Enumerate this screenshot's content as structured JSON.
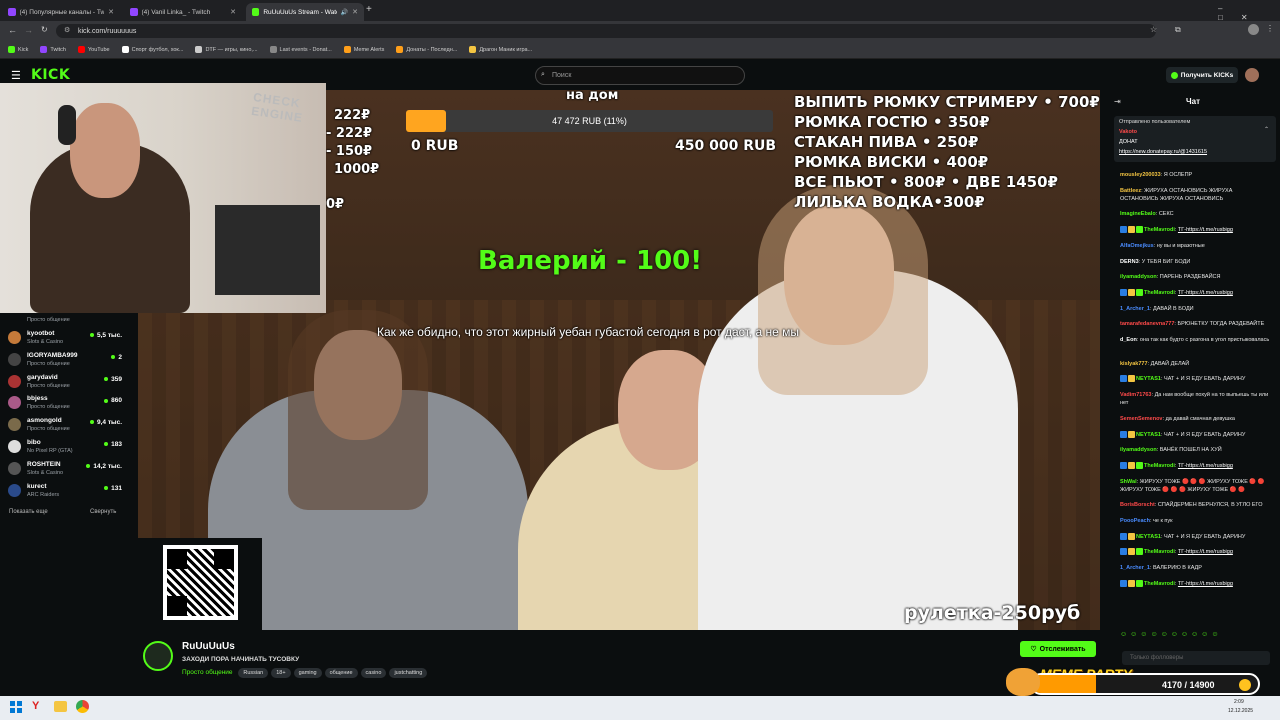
{
  "browser": {
    "tabs": [
      {
        "title": "(4) Популярные каналы - Twitch",
        "color": "#9146ff",
        "active": false
      },
      {
        "title": "(4) Vanil Linka_ - Twitch",
        "color": "#9146ff",
        "active": false
      },
      {
        "title": "RuUuUuUs Stream - Watch",
        "color": "#53fc18",
        "active": true
      }
    ],
    "url": "kick.com/ruuuuuus",
    "bookmarks": [
      {
        "label": "Kick",
        "color": "#53fc18"
      },
      {
        "label": "Twitch",
        "color": "#9146ff"
      },
      {
        "label": "YouTube",
        "color": "#ff0000"
      },
      {
        "label": "Спорт футбол, хок...",
        "color": "#ffffff"
      },
      {
        "label": "DTF — игры, кино,...",
        "color": "#cccccc"
      },
      {
        "label": "Last events - Donat...",
        "color": "#888888"
      },
      {
        "label": "Meme Alerts",
        "color": "#ff9f1a"
      },
      {
        "label": "Донаты - Последн...",
        "color": "#ff9f1a"
      },
      {
        "label": "Драгон Маник игра...",
        "color": "#f4c542"
      }
    ]
  },
  "header": {
    "logo": "KICK",
    "search_placeholder": "Поиск",
    "get_kicks": "Получить KICKs"
  },
  "sidebar": {
    "top_category": "Просто общение",
    "channels": [
      {
        "name": "kyootbot",
        "category": "Slots & Casino",
        "viewers": "5,5 тыс.",
        "color": "#c47a3a"
      },
      {
        "name": "IGORYAMBA999",
        "category": "Просто общение",
        "viewers": "2",
        "color": "#444"
      },
      {
        "name": "garydavid",
        "category": "Просто общение",
        "viewers": "359",
        "color": "#a33"
      },
      {
        "name": "bbjess",
        "category": "Просто общение",
        "viewers": "860",
        "color": "#aa5a88"
      },
      {
        "name": "asmongold",
        "category": "Просто общение",
        "viewers": "9,4 тыс.",
        "color": "#7a6a4a"
      },
      {
        "name": "bibo",
        "category": "No Pixel RP (GTA)",
        "viewers": "183",
        "color": "#ddd"
      },
      {
        "name": "ROSHTEIN",
        "category": "Slots & Casino",
        "viewers": "14,2 тыс.",
        "color": "#555"
      },
      {
        "name": "kurect",
        "category": "ARC Raiders",
        "viewers": "131",
        "color": "#2a4a8a"
      }
    ],
    "show_more": "Показать еще",
    "collapse": "Свернуть"
  },
  "video": {
    "price_list": [
      "ВЫПИТЬ РЮМКУ СТРИМЕРУ • 700₽",
      "РЮМКА ГОСТЮ • 350₽",
      "СТАКАН ПИВА • 250₽",
      "РЮМКА ВИСКИ • 400₽",
      "ВСЕ ПЬЮТ • 800₽ • ДВЕ 1450₽",
      "ЛИЛЬКА ВОДКА•300₽"
    ],
    "left_prices": [
      "222₽",
      "- 222₽",
      "- 150₽",
      "1000₽",
      "0₽"
    ],
    "goal_title": "на дом",
    "goal_progress": 0.11,
    "goal_text": "47 472 RUB (11%)",
    "goal_min": "0 RUB",
    "goal_max": "450 000 RUB",
    "donation_alert": "Валерий - 100!",
    "donation_message": "Как же обидно, что этот жирный уебан губастой сегодня в рот даст, а не мы",
    "roulette": "рулетка-250руб",
    "cam_sign": "CHECK ENGINE"
  },
  "stream_info": {
    "channel": "RuUuUuUs",
    "title": "ЗАХОДИ ПОРА НАЧИНАТЬ ТУСОВКУ",
    "category": "Просто общение",
    "tags": [
      "Russian",
      "18+",
      "gaming",
      "общение",
      "casino",
      "justchatting"
    ],
    "follow_label": "Отслеживать"
  },
  "chat": {
    "title": "Чат",
    "pinned_by": "Отправлено пользователем",
    "pinned_user": "Vakoto",
    "pinned_donate": "ДОНАТ",
    "pinned_link": "https://new.donatepay.ru/@1431615",
    "messages": [
      {
        "user": "mousley200033",
        "text": "Я ОСЛЕПР",
        "color": "#f4c542",
        "badges": 0,
        "link": false
      },
      {
        "user": "Battleez",
        "text": "ЖИРУХА ОСТАНОВИСЬ ЖИРУХА ОСТАНОВИСЬ ЖИРУХА ОСТАНОВИСЬ",
        "color": "#f4c542",
        "badges": 0,
        "link": false
      },
      {
        "user": "ImagineEbalo",
        "text": "СЕКС",
        "color": "#53fc18",
        "badges": 0,
        "link": false
      },
      {
        "user": "TheMavrodi",
        "text": "ТГ-https://t.me/rusbigg",
        "color": "#53fc18",
        "badges": 3,
        "link": true
      },
      {
        "user": "AlfaOmejkus",
        "text": "ну вы и мразотные",
        "color": "#4a8cff",
        "badges": 0,
        "link": false
      },
      {
        "user": "DERN3",
        "text": "У ТЕБЯ БИГ БОДИ",
        "color": "#ffffff",
        "badges": 0,
        "link": false
      },
      {
        "user": "ilyamaddyson",
        "text": "ПАРЕНЬ РАЗДЕВАЙСЯ",
        "color": "#53fc18",
        "badges": 0,
        "link": false
      },
      {
        "user": "TheMavrodi",
        "text": "ТГ-https://t.me/rusbigg",
        "color": "#53fc18",
        "badges": 3,
        "link": true
      },
      {
        "user": "1_Archer_1",
        "text": "ДАВАЙ В БОДИ",
        "color": "#4a8cff",
        "badges": 0,
        "link": false
      },
      {
        "user": "tamarafedanevna777",
        "text": "БРЮНЕТКУ ТОГДА РАЗДЕВАЙТЕ",
        "color": "#ff4a4a",
        "badges": 0,
        "link": false
      },
      {
        "user": "d_Eon",
        "text": "она так как будто с разгона в угол пристыковалась",
        "color": "#ffffff",
        "badges": 0,
        "link": false
      },
      {
        "user": "kislyak777",
        "text": "ДАВАЙ ДЕЛАЙ",
        "color": "#f4c542",
        "badges": 0,
        "link": false
      },
      {
        "user": "NEYTAS1",
        "text": "ЧАТ + И Я ЕДУ ЕБАТЬ ДАРИНУ",
        "color": "#53fc18",
        "badges": 2,
        "link": false
      },
      {
        "user": "Vadim71763",
        "text": "Да нам вообще похуй на то выпьешь ты или нет",
        "color": "#ff4a4a",
        "badges": 0,
        "link": false
      },
      {
        "user": "SemenSemenov",
        "text": "да давай смачная девушка",
        "color": "#ff4a4a",
        "badges": 0,
        "link": false
      },
      {
        "user": "NEYTAS1",
        "text": "ЧАТ + И Я ЕДУ ЕБАТЬ ДАРИНУ",
        "color": "#53fc18",
        "badges": 2,
        "link": false
      },
      {
        "user": "ilyamaddyson",
        "text": "ВАНЁК ПОШЕЛ НА ХУЙ",
        "color": "#53fc18",
        "badges": 0,
        "link": false
      },
      {
        "user": "TheMavrodi",
        "text": "ТГ-https://t.me/rusbigg",
        "color": "#53fc18",
        "badges": 3,
        "link": true
      },
      {
        "user": "ShWal",
        "text": "ЖИРУХУ ТОЖЕ 🔴 🔴 🔴 ЖИРУХУ ТОЖЕ 🔴 🔴 ЖИРУХУ ТОЖЕ 🔴 🔴 🔴 ЖИРУХУ ТОЖЕ 🔴 🔴",
        "color": "#53fc18",
        "badges": 0,
        "link": false
      },
      {
        "user": "BorisBorscht",
        "text": "СПАЙДЕРМЕН ВЕРНУЛСЯ, В УГЛО ЕГО",
        "color": "#ff4a4a",
        "badges": 0,
        "link": false
      },
      {
        "user": "PoooPeach",
        "text": "че к пук",
        "color": "#4a8cff",
        "badges": 0,
        "link": false
      },
      {
        "user": "NEYTAS1",
        "text": "ЧАТ + И Я ЕДУ ЕБАТЬ ДАРИНУ",
        "color": "#53fc18",
        "badges": 2,
        "link": false
      },
      {
        "user": "TheMavrodi",
        "text": "ТГ-https://t.me/rusbigg",
        "color": "#53fc18",
        "badges": 3,
        "link": true
      },
      {
        "user": "1_Archer_1",
        "text": "ВАЛЕРИЮ В КАДР",
        "color": "#4a8cff",
        "badges": 0,
        "link": false
      },
      {
        "user": "TheMavrodi",
        "text": "ТГ-https://t.me/rusbigg",
        "color": "#53fc18",
        "badges": 3,
        "link": true
      }
    ],
    "input_placeholder": "Только фолловеры",
    "meme_party": "MEME PARTY",
    "meme_progress": "4170 / 14900",
    "meme_fill": 0.28
  },
  "taskbar": {
    "time": "2:09",
    "date": "12.12.2025"
  },
  "colors": {
    "kick_green": "#53fc18",
    "goal_orange": "#ffa51f"
  }
}
